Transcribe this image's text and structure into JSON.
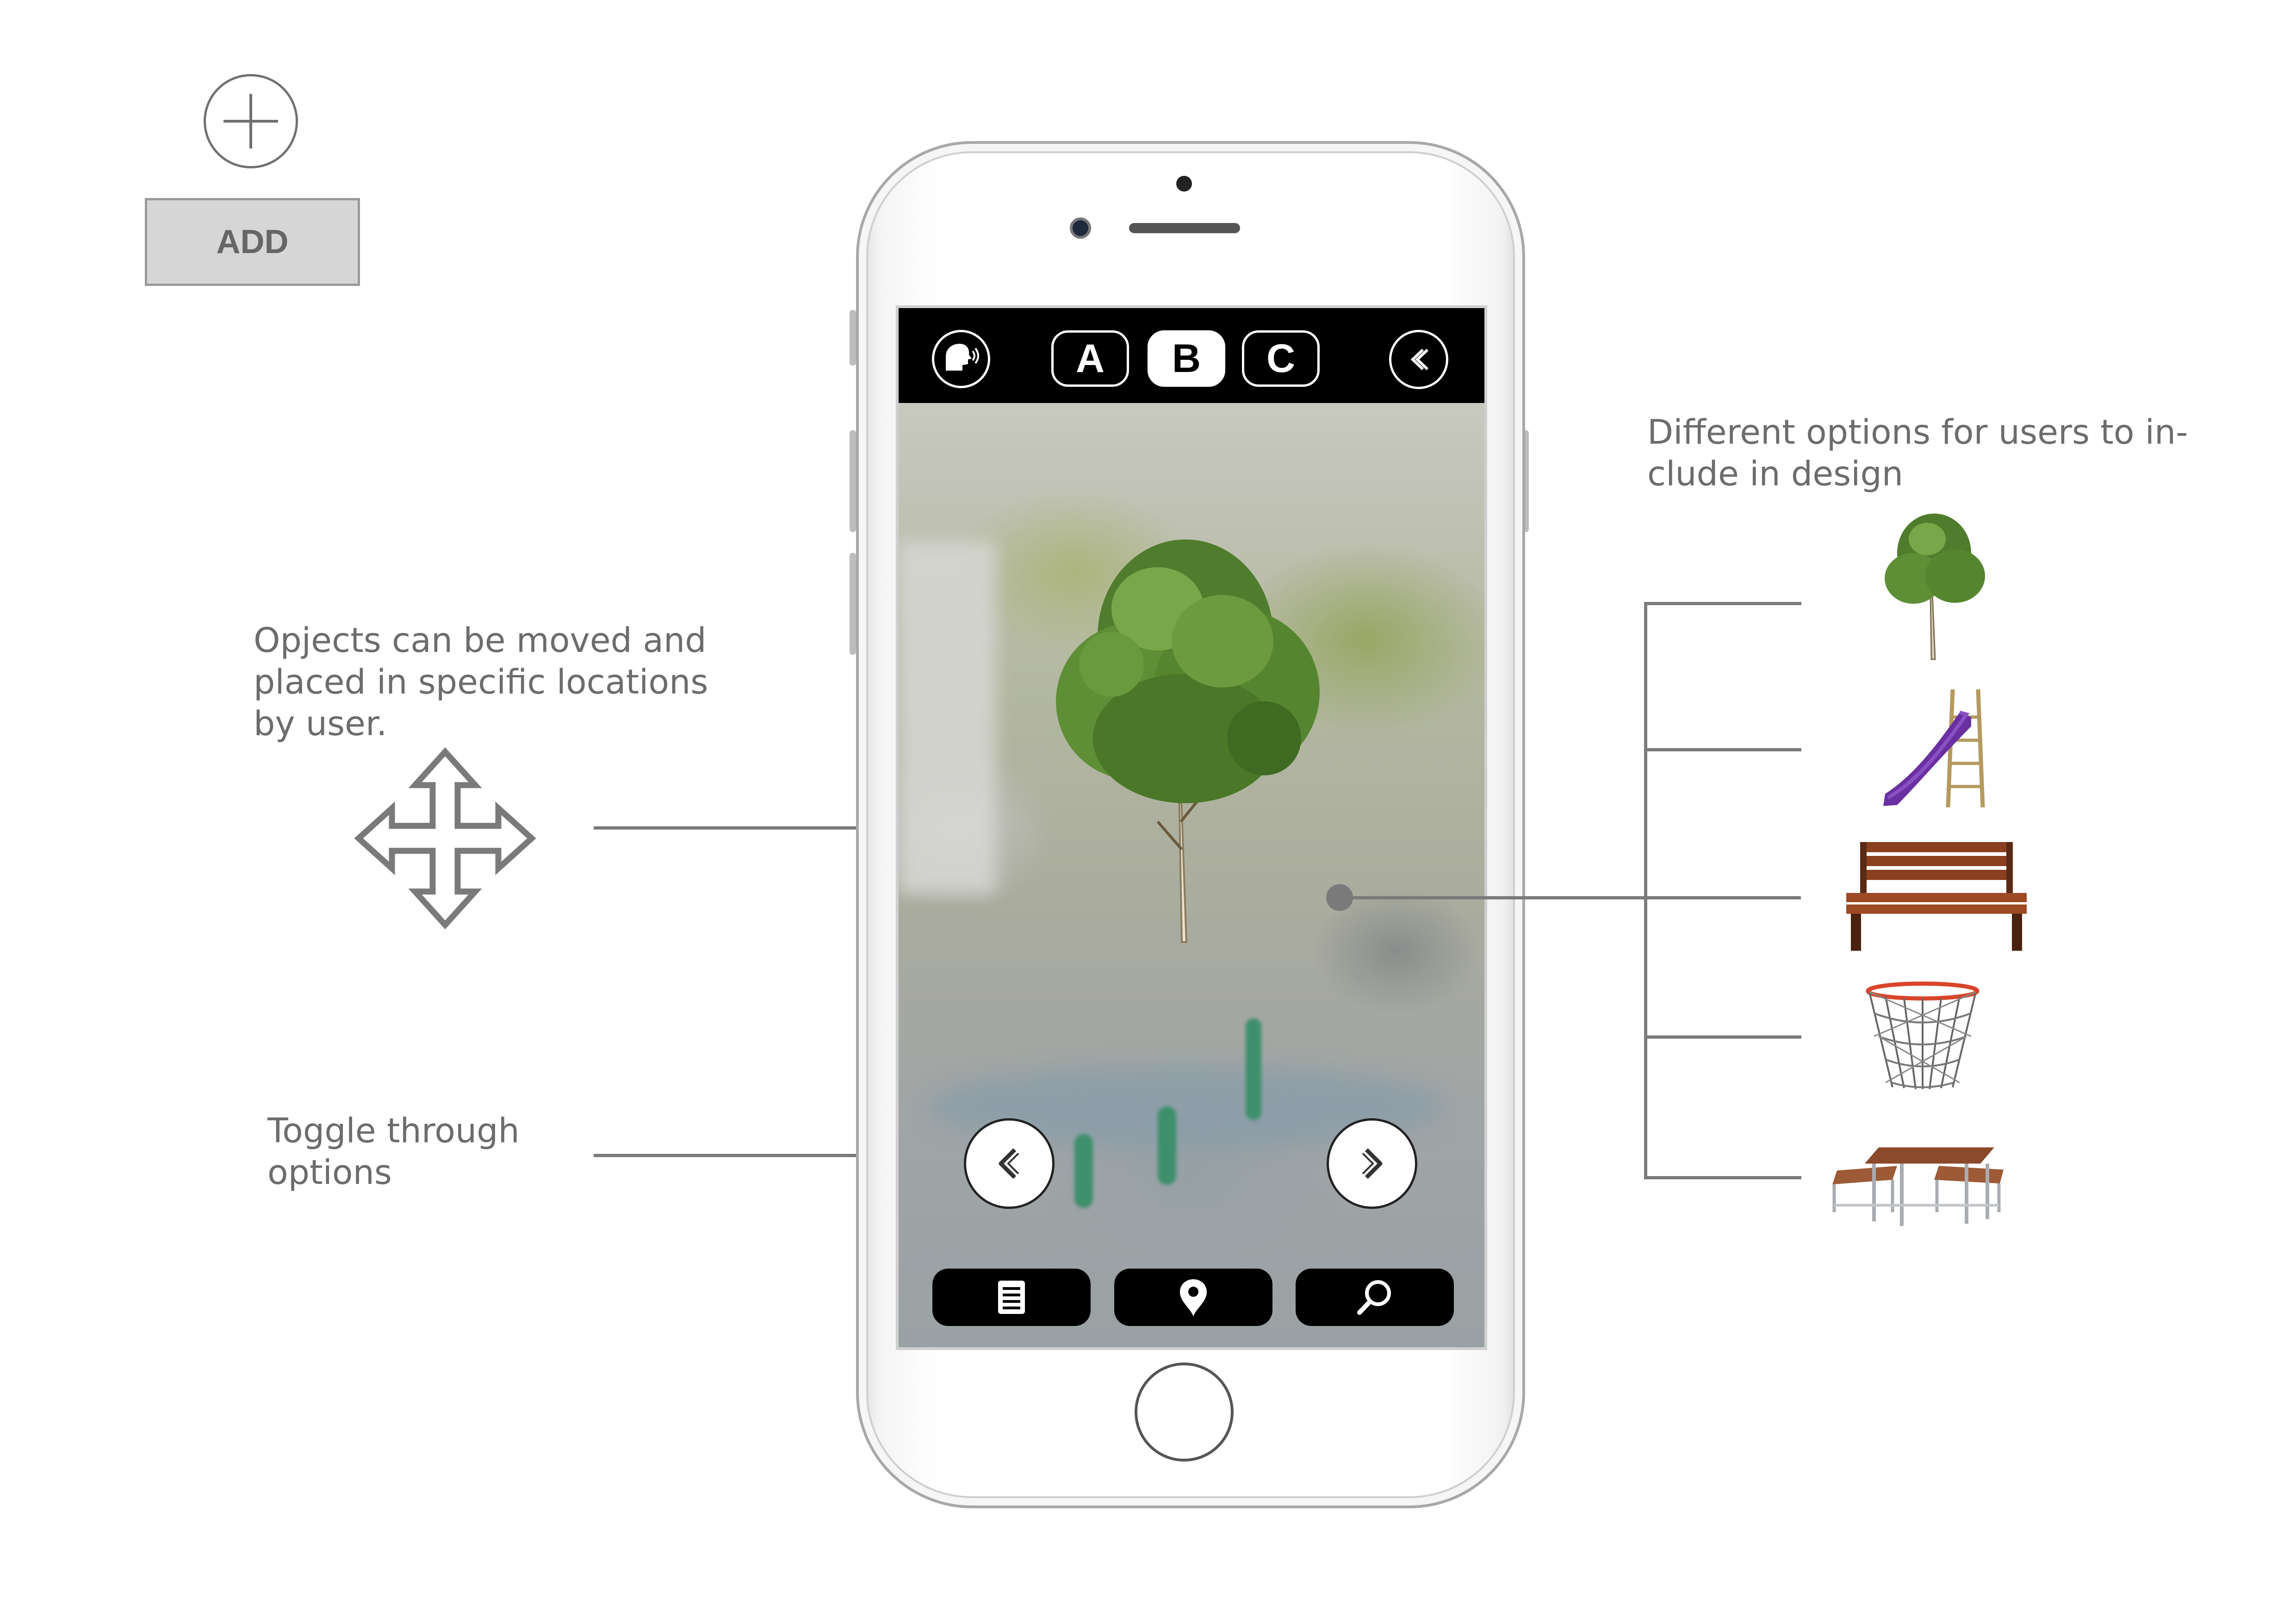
{
  "add_control": {
    "label": "ADD"
  },
  "annotations": {
    "move_note": [
      "Opjects can be moved and",
      "placed in specific locations",
      "by user."
    ],
    "toggle_note": [
      "Toggle through",
      "options"
    ],
    "options_note": [
      "Different options for users to in-",
      "clude in design"
    ]
  },
  "app": {
    "tabs": [
      {
        "label": "A",
        "active": false
      },
      {
        "label": "B",
        "active": true
      },
      {
        "label": "C",
        "active": false
      }
    ],
    "icons": {
      "audio": "speaker-head-icon",
      "back": "back-chevron-icon",
      "prev": "chevron-left-icon",
      "next": "chevron-right-icon",
      "list": "document-icon",
      "location": "map-pin-icon",
      "search": "search-icon"
    }
  },
  "options_list": [
    {
      "icon": "tree-icon"
    },
    {
      "icon": "slide-icon"
    },
    {
      "icon": "bench-icon"
    },
    {
      "icon": "basketball-hoop-icon"
    },
    {
      "icon": "picnic-table-icon"
    }
  ],
  "colors": {
    "annotation_text": "#6c6c6c",
    "connector": "#7a7a7a",
    "slide": "#6a2fa0",
    "bench_wood": "#8b3f1f"
  }
}
